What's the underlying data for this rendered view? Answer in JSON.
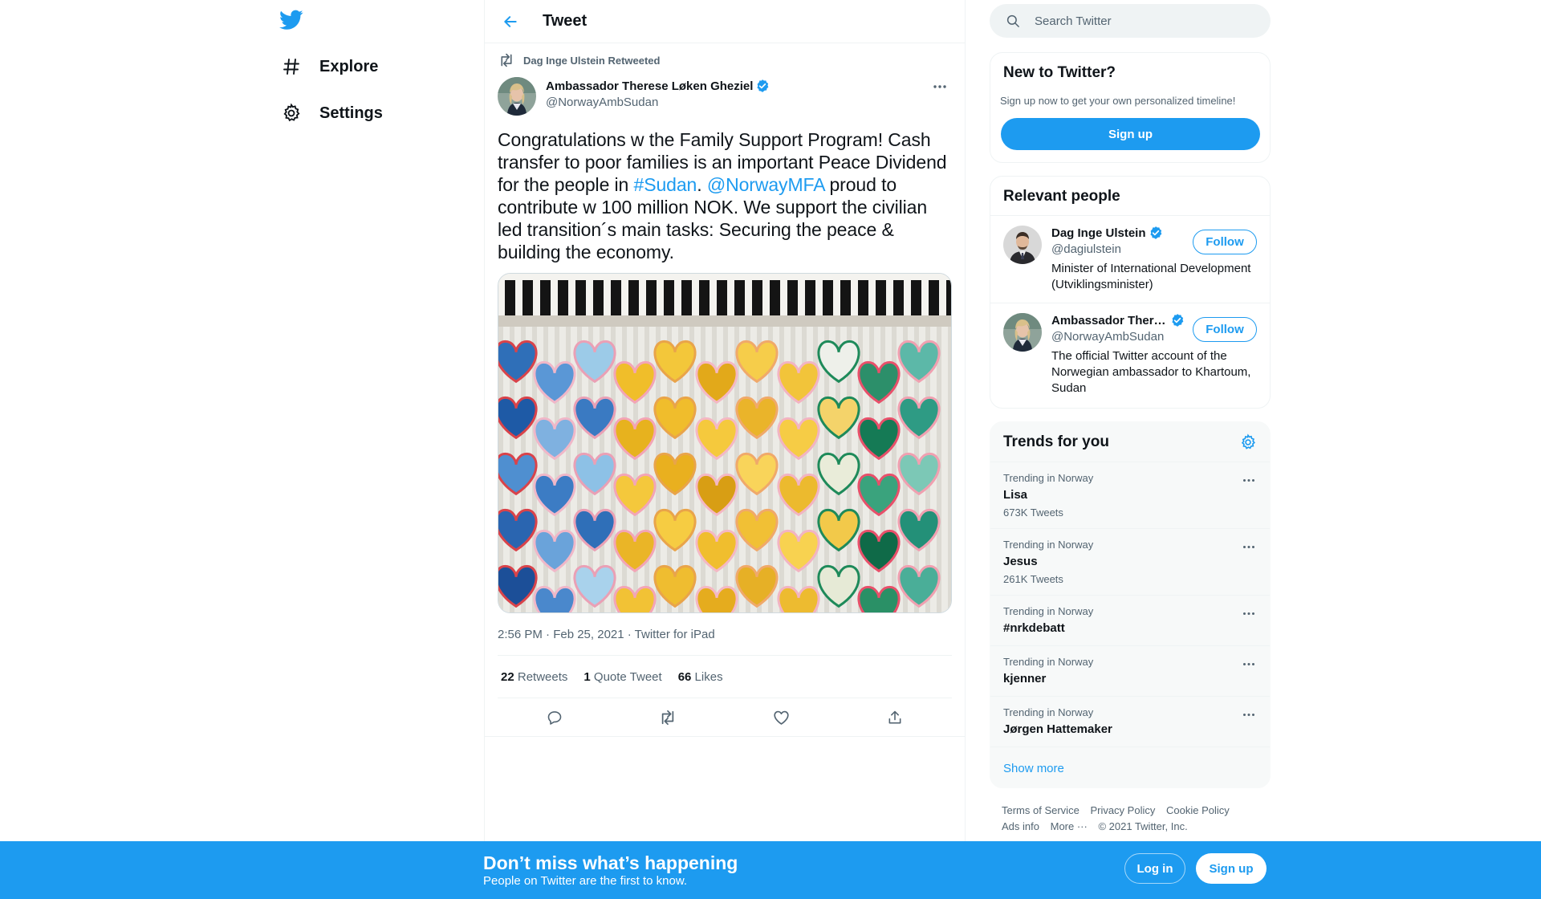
{
  "colors": {
    "accent": "#1d9bf0",
    "text": "#0f1419",
    "secondary": "#536471",
    "border": "#eff3f4"
  },
  "nav": {
    "logo_icon": "twitter-bird-icon",
    "items": [
      {
        "label": "Explore",
        "icon": "hashtag-icon"
      },
      {
        "label": "Settings",
        "icon": "gear-icon"
      }
    ]
  },
  "main": {
    "header_title": "Tweet",
    "tweet": {
      "retweet_context": "Dag Inge Ulstein Retweeted",
      "author_name": "Ambassador Therese Løken Gheziel",
      "author_handle": "@NorwayAmbSudan",
      "text": {
        "part1": "Congratulations w the Family Support Program! Cash transfer to poor families is an important Peace Dividend for the people in ",
        "hashtag": "#Sudan",
        "part2": ". ",
        "mention": "@NorwayMFA",
        "part3": " proud to contribute w 100 million NOK. We support the civilian led transition´s main tasks: Securing the peace & building the economy."
      },
      "timestamp": "2:56 PM · Feb 25, 2021 · Twitter for iPad",
      "stats": {
        "retweets_count": "22",
        "retweets_label": "Retweets",
        "quotes_count": "1",
        "quotes_label": "Quote Tweet",
        "likes_count": "66",
        "likes_label": "Likes"
      }
    }
  },
  "sidebar": {
    "search_placeholder": "Search Twitter",
    "new_to_twitter": {
      "title": "New to Twitter?",
      "subtitle": "Sign up now to get your own personalized timeline!",
      "signup_label": "Sign up"
    },
    "relevant_people": {
      "title": "Relevant people",
      "people": [
        {
          "name": "Dag Inge Ulstein",
          "handle": "@dagiulstein",
          "bio": "Minister of International Development (Utviklingsminister)",
          "follow_label": "Follow"
        },
        {
          "name": "Ambassador Therese Løken Gheziel",
          "handle": "@NorwayAmbSudan",
          "bio": "The official Twitter account of the Norwegian ambassador to Khartoum, Sudan",
          "follow_label": "Follow"
        }
      ]
    },
    "trends": {
      "title": "Trends for you",
      "items": [
        {
          "context": "Trending in Norway",
          "name": "Lisa",
          "count": "673K Tweets"
        },
        {
          "context": "Trending in Norway",
          "name": "Jesus",
          "count": "261K Tweets"
        },
        {
          "context": "Trending in Norway",
          "name": "#nrkdebatt",
          "count": ""
        },
        {
          "context": "Trending in Norway",
          "name": "kjenner",
          "count": ""
        },
        {
          "context": "Trending in Norway",
          "name": "Jørgen Hattemaker",
          "count": ""
        }
      ],
      "show_more": "Show more"
    },
    "footer": {
      "terms": "Terms of Service",
      "privacy": "Privacy Policy",
      "cookie": "Cookie Policy",
      "ads": "Ads info",
      "more": "More ···",
      "copyright": "© 2021 Twitter, Inc."
    }
  },
  "bottom_bar": {
    "title": "Don’t miss what’s happening",
    "subtitle": "People on Twitter are the first to know.",
    "login_label": "Log in",
    "signup_label": "Sign up"
  }
}
